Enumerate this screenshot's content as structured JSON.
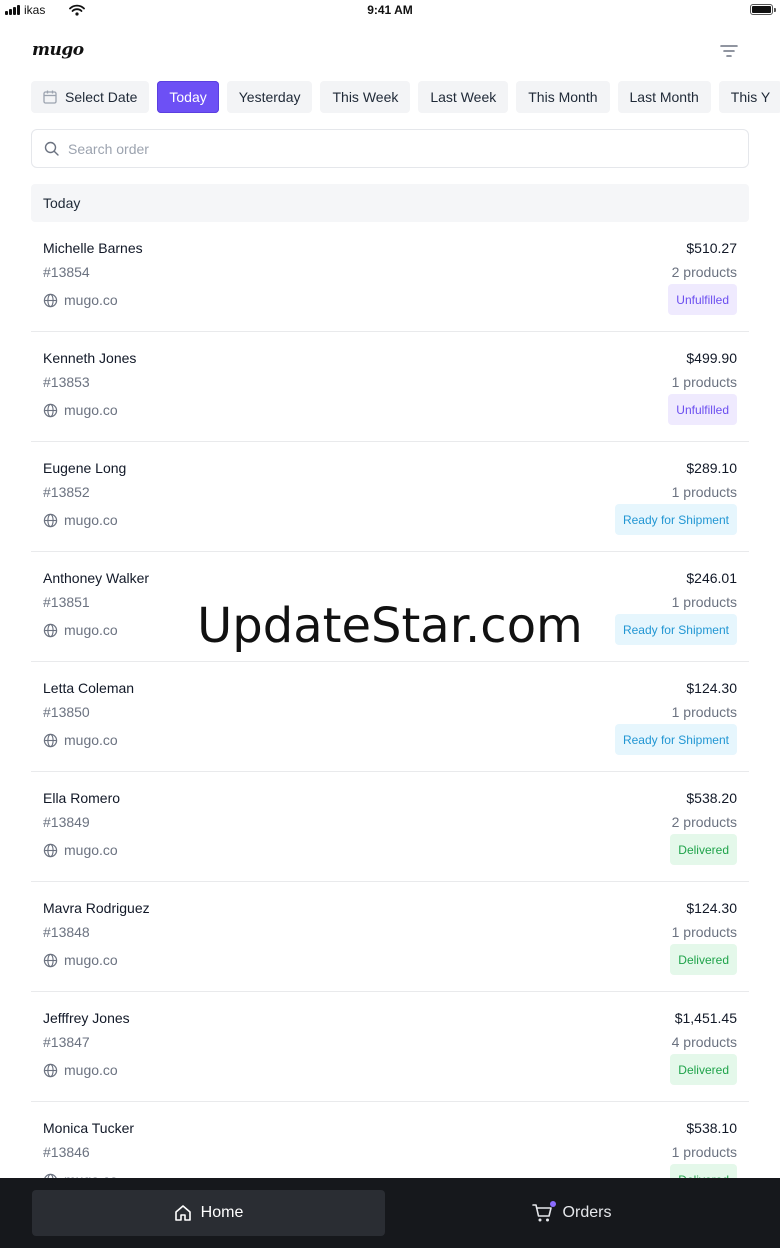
{
  "status_bar": {
    "carrier": "ikas",
    "time": "9:41 AM"
  },
  "header": {
    "logo": "mugo"
  },
  "date_filters": {
    "select_date": "Select Date",
    "chips": [
      "Today",
      "Yesterday",
      "This Week",
      "Last Week",
      "This Month",
      "Last Month",
      "This Y"
    ],
    "active": "Today"
  },
  "search": {
    "placeholder": "Search order"
  },
  "section": {
    "title": "Today"
  },
  "orders": [
    {
      "name": "Michelle Barnes",
      "number": "#13854",
      "site": "mugo.co",
      "total": "$510.27",
      "products": "2 products",
      "status": "Unfulfilled"
    },
    {
      "name": "Kenneth Jones",
      "number": "#13853",
      "site": "mugo.co",
      "total": "$499.90",
      "products": "1 products",
      "status": "Unfulfilled"
    },
    {
      "name": "Eugene Long",
      "number": "#13852",
      "site": "mugo.co",
      "total": "$289.10",
      "products": "1 products",
      "status": "Ready for Shipment"
    },
    {
      "name": "Anthoney Walker",
      "number": "#13851",
      "site": "mugo.co",
      "total": "$246.01",
      "products": "1 products",
      "status": "Ready for Shipment"
    },
    {
      "name": "Letta Coleman",
      "number": "#13850",
      "site": "mugo.co",
      "total": "$124.30",
      "products": "1 products",
      "status": "Ready for Shipment"
    },
    {
      "name": "Ella Romero",
      "number": "#13849",
      "site": "mugo.co",
      "total": "$538.20",
      "products": "2 products",
      "status": "Delivered"
    },
    {
      "name": "Mavra Rodriguez",
      "number": "#13848",
      "site": "mugo.co",
      "total": "$124.30",
      "products": "1 products",
      "status": "Delivered"
    },
    {
      "name": "Jefffrey Jones",
      "number": "#13847",
      "site": "mugo.co",
      "total": "$1,451.45",
      "products": "4 products",
      "status": "Delivered"
    },
    {
      "name": "Monica Tucker",
      "number": "#13846",
      "site": "mugo.co",
      "total": "$538.10",
      "products": "1 products",
      "status": "Delivered"
    }
  ],
  "status_colors": {
    "Unfulfilled": "#6b4ef0",
    "Ready for Shipment": "#2196d3",
    "Delivered": "#1fa34a",
    "accent": "#6d50f5"
  },
  "watermark": "UpdateStar.com",
  "tabbar": {
    "home": "Home",
    "orders": "Orders"
  }
}
